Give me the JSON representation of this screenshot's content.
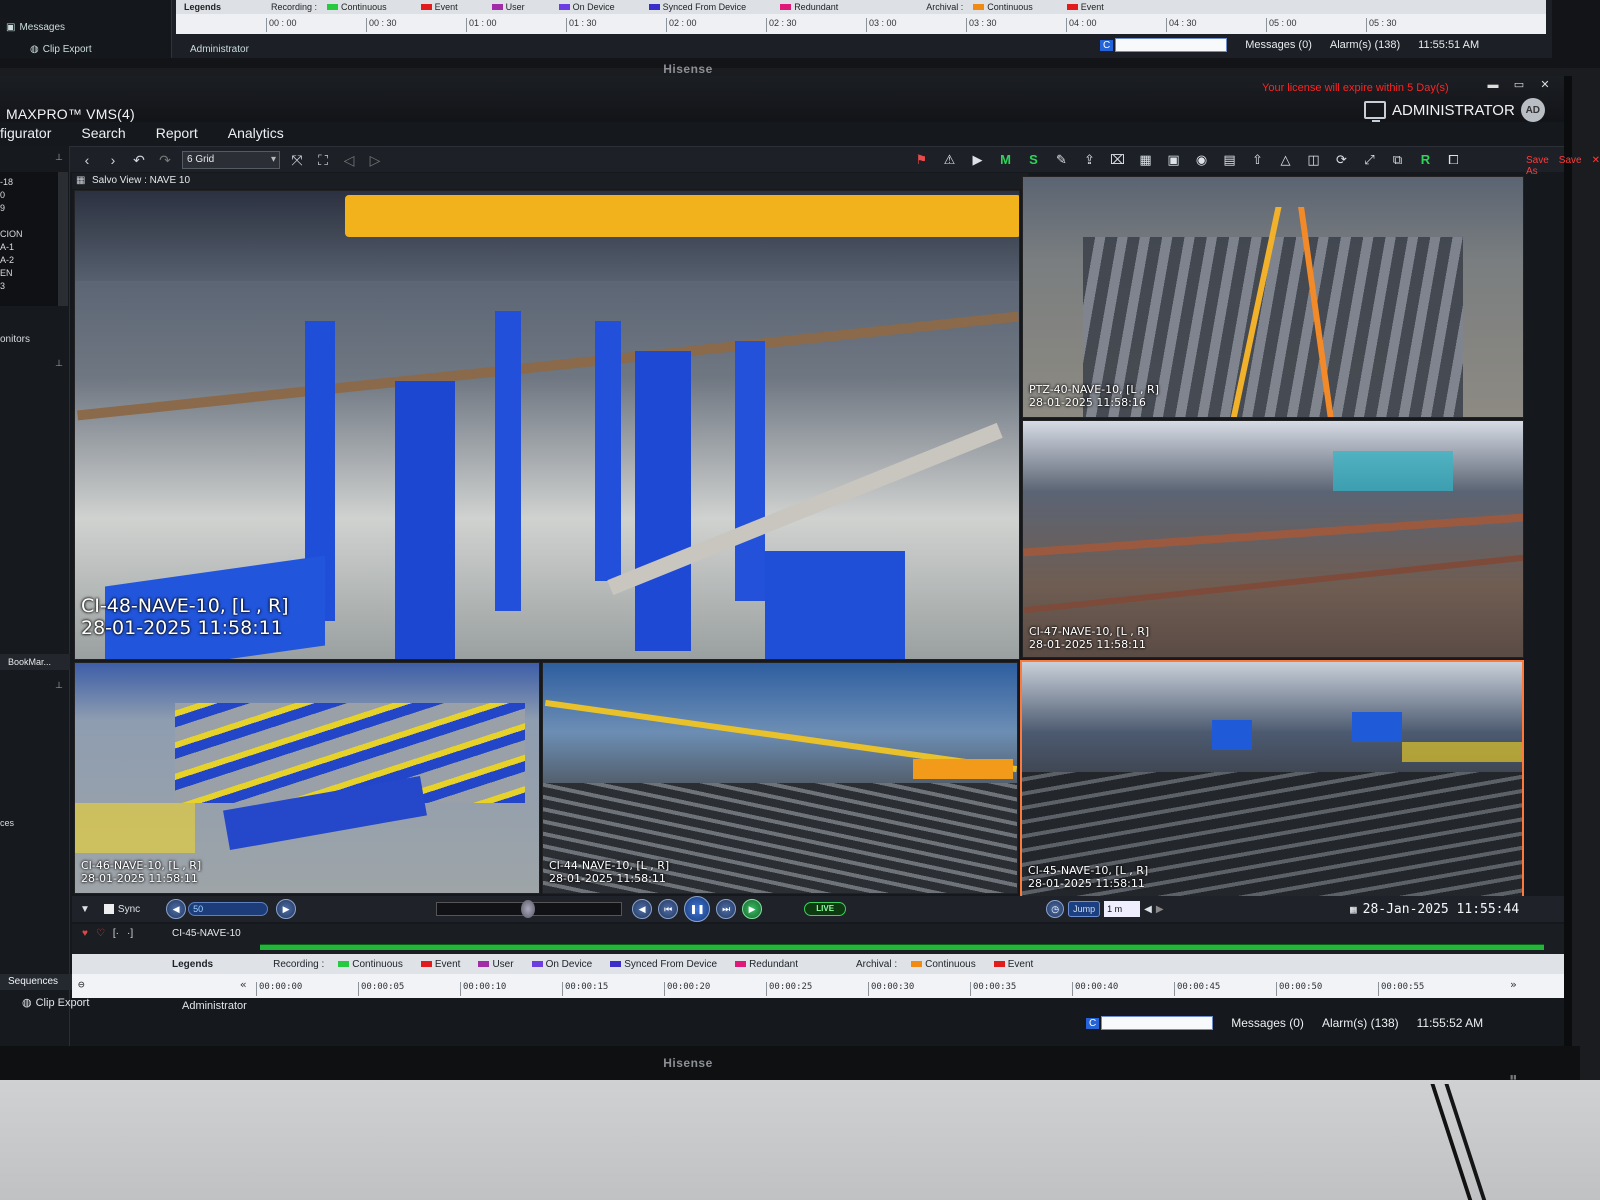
{
  "monitor": {
    "brand": "Hisense"
  },
  "top_strip": {
    "messages_tab": "Messages",
    "clip_export": "Clip Export",
    "administrator": "Administrator",
    "legends_label": "Legends",
    "recording_label": "Recording :",
    "archival_label": "Archival :",
    "legend_items": [
      "Continuous",
      "Event",
      "User",
      "On Device",
      "Synced From Device",
      "Redundant"
    ],
    "archival_items": [
      "Continuous",
      "Event"
    ],
    "ticks": [
      "00 : 00",
      "00 : 30",
      "01 : 00",
      "01 : 30",
      "02 : 00",
      "02 : 30",
      "03 : 00",
      "03 : 30",
      "04 : 00",
      "04 : 30",
      "05 : 00",
      "05 : 30"
    ],
    "messages": "Messages (0)",
    "alarms": "Alarm(s) (138)",
    "time": "11:55:51 AM"
  },
  "app": {
    "title": "MAXPRO™ VMS(4)",
    "license_warning": "Your license will expire within",
    "license_days": "5 Day(s)",
    "user": "ADMINISTRATOR",
    "user_initials": "AD",
    "menu": [
      "figurator",
      "Search",
      "Report",
      "Analytics"
    ],
    "grid_select": "6 Grid",
    "save_as": "Save As",
    "save": "Save"
  },
  "sidebar": {
    "tree_items": [
      "-18",
      "0",
      "9",
      "",
      "CION",
      "A-1",
      "A-2",
      "EN",
      "3"
    ],
    "monitors": "onitors",
    "bookmarks": "BookMar...",
    "sequences_partial": "ces",
    "sequences": "Sequences"
  },
  "salvo": {
    "title": "Salvo View : NAVE 10",
    "tiles": [
      {
        "name": "CI-48-NAVE-10, [L , R]",
        "ts": "28-01-2025 11:58:11"
      },
      {
        "name": "PTZ-40-NAVE-10, [L , R]",
        "ts": "28-01-2025 11:58:16"
      },
      {
        "name": "CI-47-NAVE-10, [L , R]",
        "ts": "28-01-2025 11:58:11"
      },
      {
        "name": "CI-46-NAVE-10, [L , R]",
        "ts": "28-01-2025 11:58:11"
      },
      {
        "name": "CI-44-NAVE-10, [L , R]",
        "ts": "28-01-2025 11:58:11"
      },
      {
        "name": "CI-45-NAVE-10, [L , R]",
        "ts": "28-01-2025 11:58:11"
      }
    ]
  },
  "playback": {
    "sync": "Sync",
    "speed": "50",
    "live": "LIVE",
    "jump": "Jump",
    "jump_value": "1 m",
    "current_datetime": "28-Jan-2025 11:55:44",
    "track_camera": "CI-45-NAVE-10"
  },
  "timeline": {
    "legends_label": "Legends",
    "recording_label": "Recording :",
    "archival_label": "Archival :",
    "legend_items": [
      "Continuous",
      "Event",
      "User",
      "On Device",
      "Synced From Device",
      "Redundant"
    ],
    "archival_items": [
      "Continuous",
      "Event"
    ],
    "ticks": [
      "00:00:00",
      "00:00:05",
      "00:00:10",
      "00:00:15",
      "00:00:20",
      "00:00:25",
      "00:00:30",
      "00:00:35",
      "00:00:40",
      "00:00:45",
      "00:00:50",
      "00:00:55"
    ]
  },
  "footer": {
    "clip_export": "Clip Export",
    "administrator": "Administrator",
    "status_c": "C",
    "messages": "Messages (0)",
    "alarms": "Alarm(s) (138)",
    "time": "11:55:52 AM"
  },
  "colors": {
    "continuous": "#27c93f",
    "event": "#e21c1c",
    "user": "#a22ca8",
    "on_device": "#6a3ee0",
    "synced": "#3b2fc9",
    "redundant": "#e0187a",
    "archival_continuous": "#f08a12",
    "license_red": "#ff2323",
    "selected_border": "#ff7a3a"
  },
  "icons": {
    "toolbar": [
      "nav-back-icon",
      "nav-forward-icon",
      "undo-icon",
      "redo-icon",
      "fit-icon",
      "fullscreen-icon",
      "prev-page-icon",
      "next-page-icon"
    ]
  }
}
